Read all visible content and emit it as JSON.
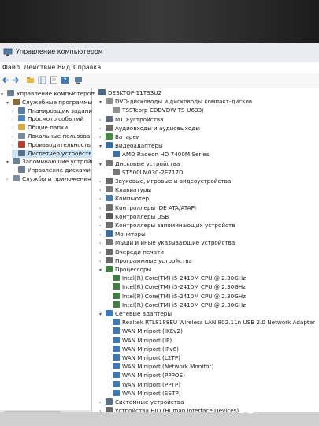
{
  "window": {
    "title": "Управление компьютером"
  },
  "menu": [
    "Файл",
    "Действие",
    "Вид",
    "Справка"
  ],
  "left_tree": [
    {
      "label": "Управление компьютером (л",
      "level": 0,
      "arrow": "▾",
      "icon": "#6a7d92"
    },
    {
      "label": "Служебные программы",
      "level": 1,
      "arrow": "▾",
      "icon": "#8a6d3b"
    },
    {
      "label": "Планировщик задани",
      "level": 2,
      "arrow": "›",
      "icon": "#5a7fa6"
    },
    {
      "label": "Просмотр событий",
      "level": 2,
      "arrow": "›",
      "icon": "#4b86c2"
    },
    {
      "label": "Общие папки",
      "level": 2,
      "arrow": "›",
      "icon": "#d9a93a"
    },
    {
      "label": "Локальные пользова",
      "level": 2,
      "arrow": "›",
      "icon": "#7a8a9c"
    },
    {
      "label": "Производительность",
      "level": 2,
      "arrow": "›",
      "icon": "#c0392b"
    },
    {
      "label": "Диспетчер устройств",
      "level": 2,
      "arrow": "",
      "icon": "#5b6f84",
      "selected": true
    },
    {
      "label": "Запоминающие устройств",
      "level": 1,
      "arrow": "▾",
      "icon": "#6d7f93"
    },
    {
      "label": "Управление дисками",
      "level": 2,
      "arrow": "",
      "icon": "#6d7f93"
    },
    {
      "label": "Службы и приложения",
      "level": 1,
      "arrow": "›",
      "icon": "#7d8c9e"
    }
  ],
  "device_tree": [
    {
      "label": "DESKTOP-11TS3U2",
      "level": 0,
      "arrow": "▾",
      "icon": "#4a6a8a"
    },
    {
      "label": "DVD-дисководы и дисководы компакт-дисков",
      "level": 1,
      "arrow": "▾",
      "icon": "#8f8f8f"
    },
    {
      "label": "TSSTcorp CDDVDW TS-U633J",
      "level": 2,
      "arrow": "",
      "icon": "#8f8f8f"
    },
    {
      "label": "MTD-устройства",
      "level": 1,
      "arrow": "›",
      "icon": "#5e6e7e"
    },
    {
      "label": "Аудиовходы и аудиовыходы",
      "level": 1,
      "arrow": "›",
      "icon": "#6c6c6c"
    },
    {
      "label": "Батареи",
      "level": 1,
      "arrow": "›",
      "icon": "#3f8f3f"
    },
    {
      "label": "Видеоадаптеры",
      "level": 1,
      "arrow": "▾",
      "icon": "#3c6fa8"
    },
    {
      "label": "AMD Radeon HD 7400M Series",
      "level": 2,
      "arrow": "",
      "icon": "#3c6fa8"
    },
    {
      "label": "Дисковые устройства",
      "level": 1,
      "arrow": "▾",
      "icon": "#777777"
    },
    {
      "label": "ST500LM030-2E717D",
      "level": 2,
      "arrow": "",
      "icon": "#777777"
    },
    {
      "label": "Звуковые, игровые и видеоустройства",
      "level": 1,
      "arrow": "›",
      "icon": "#6a6a6a"
    },
    {
      "label": "Клавиатуры",
      "level": 1,
      "arrow": "›",
      "icon": "#7a7a7a"
    },
    {
      "label": "Компьютер",
      "level": 1,
      "arrow": "›",
      "icon": "#4d7aa8"
    },
    {
      "label": "Контроллеры IDE ATA/ATAPI",
      "level": 1,
      "arrow": "›",
      "icon": "#6f6f6f"
    },
    {
      "label": "Контроллеры USB",
      "level": 1,
      "arrow": "›",
      "icon": "#5a5a5a"
    },
    {
      "label": "Контроллеры запоминающих устройств",
      "level": 1,
      "arrow": "›",
      "icon": "#6f6f6f"
    },
    {
      "label": "Мониторы",
      "level": 1,
      "arrow": "›",
      "icon": "#3f6fa0"
    },
    {
      "label": "Мыши и иные указывающие устройства",
      "level": 1,
      "arrow": "›",
      "icon": "#777777"
    },
    {
      "label": "Очереди печати",
      "level": 1,
      "arrow": "›",
      "icon": "#6a6a6a"
    },
    {
      "label": "Программные устройства",
      "level": 1,
      "arrow": "›",
      "icon": "#6a6a6a"
    },
    {
      "label": "Процессоры",
      "level": 1,
      "arrow": "▾",
      "icon": "#3f7f3f"
    },
    {
      "label": "Intel(R) Core(TM) i5-2410M CPU @ 2.30GHz",
      "level": 2,
      "arrow": "",
      "icon": "#3f7f3f"
    },
    {
      "label": "Intel(R) Core(TM) i5-2410M CPU @ 2.30GHz",
      "level": 2,
      "arrow": "",
      "icon": "#3f7f3f"
    },
    {
      "label": "Intel(R) Core(TM) i5-2410M CPU @ 2.30GHz",
      "level": 2,
      "arrow": "",
      "icon": "#3f7f3f"
    },
    {
      "label": "Intel(R) Core(TM) i5-2410M CPU @ 2.30GHz",
      "level": 2,
      "arrow": "",
      "icon": "#3f7f3f"
    },
    {
      "label": "Сетевые адаптеры",
      "level": 1,
      "arrow": "▾",
      "icon": "#3a7ab8"
    },
    {
      "label": "Realtek RTL8188EU Wireless LAN 802.11n USB 2.0 Network Adapter",
      "level": 2,
      "arrow": "",
      "icon": "#3a7ab8"
    },
    {
      "label": "WAN Miniport (IKEv2)",
      "level": 2,
      "arrow": "",
      "icon": "#3a7ab8"
    },
    {
      "label": "WAN Miniport (IP)",
      "level": 2,
      "arrow": "",
      "icon": "#3a7ab8"
    },
    {
      "label": "WAN Miniport (IPv6)",
      "level": 2,
      "arrow": "",
      "icon": "#3a7ab8"
    },
    {
      "label": "WAN Miniport (L2TP)",
      "level": 2,
      "arrow": "",
      "icon": "#3a7ab8"
    },
    {
      "label": "WAN Miniport (Network Monitor)",
      "level": 2,
      "arrow": "",
      "icon": "#3a7ab8"
    },
    {
      "label": "WAN Miniport (PPPOE)",
      "level": 2,
      "arrow": "",
      "icon": "#3a7ab8"
    },
    {
      "label": "WAN Miniport (PPTP)",
      "level": 2,
      "arrow": "",
      "icon": "#3a7ab8"
    },
    {
      "label": "WAN Miniport (SSTP)",
      "level": 2,
      "arrow": "",
      "icon": "#3a7ab8"
    },
    {
      "label": "Системные устройства",
      "level": 1,
      "arrow": "›",
      "icon": "#5a6f86"
    },
    {
      "label": "Устройства HID (Human Interface Devices)",
      "level": 1,
      "arrow": "›",
      "icon": "#6a6a6a"
    }
  ],
  "watermark": "Avito"
}
